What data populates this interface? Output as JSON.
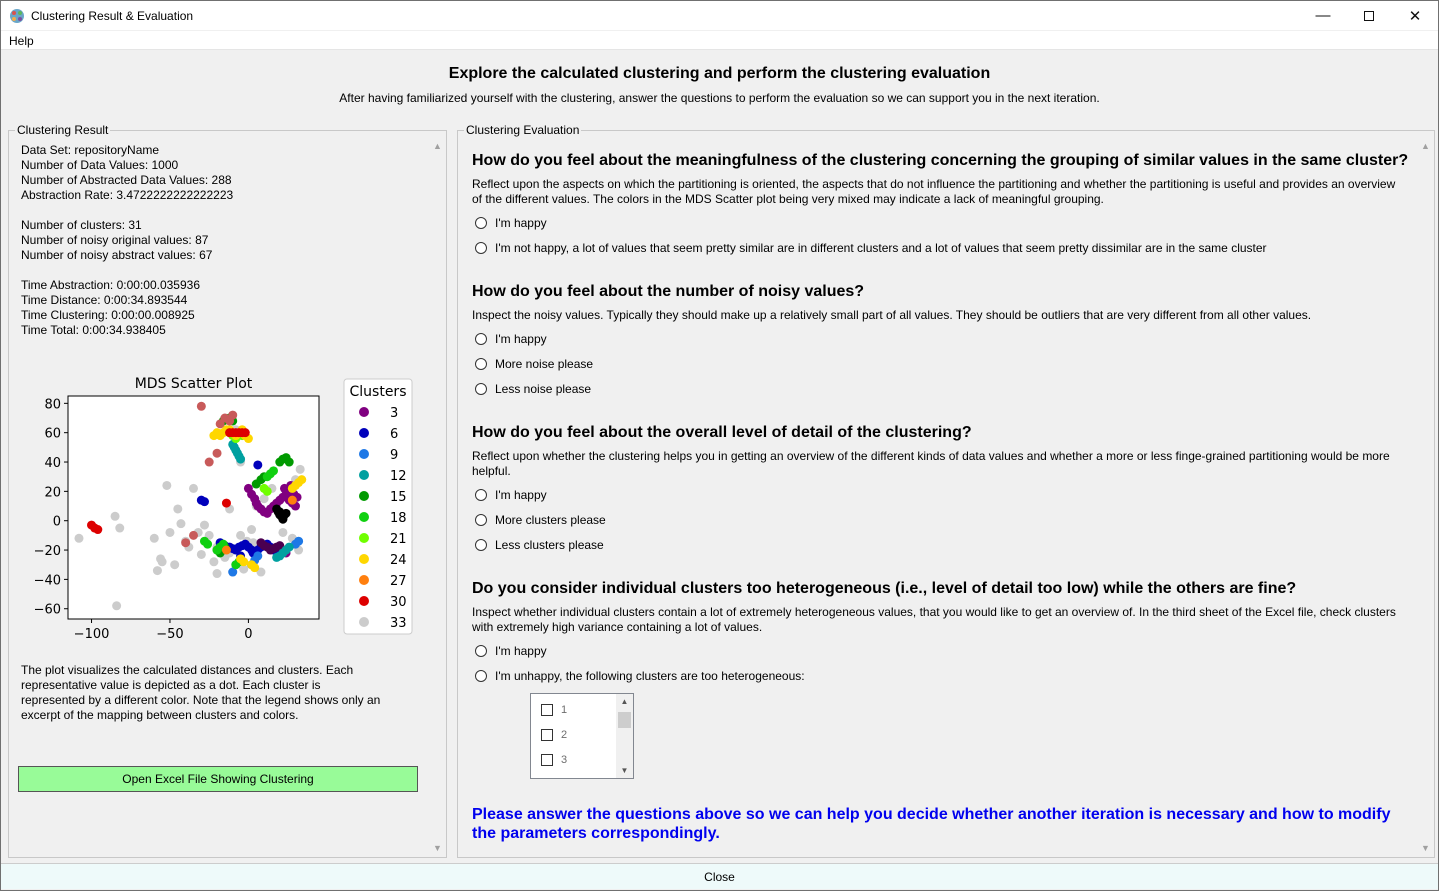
{
  "window": {
    "title": "Clustering Result & Evaluation",
    "minimize_icon": "minimize-icon",
    "maximize_icon": "maximize-icon",
    "close_icon": "close-icon"
  },
  "menu": {
    "help": "Help"
  },
  "header": {
    "title": "Explore the calculated clustering and perform the clustering evaluation",
    "subtitle": "After having familiarized yourself with the clustering, answer the questions to perform the evaluation so we can support you in the next iteration."
  },
  "left": {
    "group_title": "Clustering Result",
    "stats": [
      "Data Set: repositoryName",
      "Number of Data Values: 1000",
      "Number of Abstracted Data Values: 288",
      "Abstraction Rate: 3.4722222222222223",
      "",
      "Number of clusters: 31",
      "Number of noisy original values: 87",
      "Number of noisy abstract values: 67",
      "",
      "Time Abstraction: 0:00:00.035936",
      "Time Distance: 0:00:34.893544",
      "Time Clustering: 0:00:00.008925",
      "Time Total: 0:00:34.938405"
    ],
    "explanation": "The plot visualizes the calculated distances and clusters. Each representative value is depicted as a dot. Each cluster is represented by a different color. Note that the legend shows only an excerpt of the mapping between clusters and colors.",
    "excel_button": "Open Excel File Showing Clustering"
  },
  "chart_data": {
    "type": "scatter",
    "title": "MDS Scatter Plot",
    "xlabel": "",
    "ylabel": "",
    "xlim": [
      -115,
      45
    ],
    "ylim": [
      -67,
      85
    ],
    "x_ticks": [
      -100,
      -50,
      0
    ],
    "y_ticks": [
      80,
      60,
      40,
      20,
      0,
      -20,
      -40,
      -60
    ],
    "grid": false,
    "legend_title": "Clusters",
    "legend_placement": "right",
    "legend": [
      {
        "label": "3",
        "color": "#800080"
      },
      {
        "label": "6",
        "color": "#0000bb"
      },
      {
        "label": "9",
        "color": "#1e78e6"
      },
      {
        "label": "12",
        "color": "#00a0a0"
      },
      {
        "label": "15",
        "color": "#009a00"
      },
      {
        "label": "18",
        "color": "#10d010"
      },
      {
        "label": "21",
        "color": "#70ff00"
      },
      {
        "label": "24",
        "color": "#ffd700"
      },
      {
        "label": "27",
        "color": "#ff7f0e"
      },
      {
        "label": "30",
        "color": "#dd0000"
      },
      {
        "label": "33",
        "color": "#cccccc"
      }
    ],
    "series": [
      {
        "color": "#cccccc",
        "x": [
          -108,
          -85,
          -82,
          -60,
          -56,
          -52,
          -50,
          -47,
          -43,
          -40,
          -35,
          -30,
          -28,
          -25,
          -22,
          -20,
          -18,
          -12,
          -10,
          -8,
          -5,
          -3,
          -1,
          2,
          5,
          10,
          15,
          18,
          -55,
          -45,
          -38,
          -32,
          -15,
          -5,
          22,
          28,
          32,
          -84,
          -58,
          -20,
          -12,
          3,
          8,
          30,
          33
        ],
        "y": [
          -12,
          3,
          -5,
          -12,
          -26,
          24,
          -8,
          -30,
          -2,
          -14,
          22,
          -23,
          -3,
          -10,
          -28,
          -36,
          -15,
          -22,
          -35,
          62,
          40,
          -33,
          -14,
          -6,
          10,
          15,
          22,
          -18,
          -28,
          8,
          -18,
          -8,
          -25,
          -10,
          -8,
          -12,
          -20,
          -58,
          -34,
          -18,
          8,
          -15,
          -35,
          28,
          35
        ]
      },
      {
        "color": "#800080",
        "x": [
          0,
          2,
          4,
          5,
          6,
          8,
          10,
          12,
          14,
          16,
          18,
          20,
          22,
          24,
          26,
          28,
          30,
          25,
          23,
          27,
          29,
          31,
          20,
          22,
          24
        ],
        "y": [
          22,
          18,
          15,
          12,
          10,
          8,
          6,
          5,
          8,
          10,
          12,
          14,
          16,
          18,
          14,
          12,
          10,
          20,
          22,
          24,
          18,
          16,
          -18,
          -20,
          -22
        ]
      },
      {
        "color": "#0000bb",
        "x": [
          -18,
          -15,
          -12,
          -10,
          -8,
          -6,
          -4,
          -2,
          0,
          2,
          4,
          6,
          8,
          10,
          12,
          14,
          16,
          18,
          -30,
          -28,
          -5,
          3,
          6
        ],
        "y": [
          -15,
          -17,
          -18,
          -19,
          -20,
          -18,
          -17,
          -16,
          -18,
          -20,
          -22,
          -20,
          -18,
          -17,
          -16,
          -18,
          -20,
          -19,
          14,
          13,
          -24,
          -22,
          38
        ]
      },
      {
        "color": "#4b0050",
        "x": [
          8,
          10,
          12,
          14,
          16,
          18,
          20
        ],
        "y": [
          -15,
          -17,
          -18,
          -20,
          -19,
          -18,
          -17
        ]
      },
      {
        "color": "#000000",
        "x": [
          18,
          19,
          20,
          21,
          22,
          23,
          24,
          22,
          20
        ],
        "y": [
          8,
          6,
          4,
          3,
          2,
          4,
          5,
          1,
          6
        ]
      },
      {
        "color": "#1e78e6",
        "x": [
          -10,
          -8,
          2,
          4,
          6,
          30,
          32
        ],
        "y": [
          -35,
          -30,
          -30,
          -27,
          -24,
          -16,
          -14
        ]
      },
      {
        "color": "#00a0a0",
        "x": [
          -10,
          -9,
          -8,
          -7,
          -6,
          -5,
          18,
          20,
          22,
          24,
          26
        ],
        "y": [
          52,
          50,
          48,
          46,
          44,
          42,
          -25,
          -24,
          -22,
          -20,
          -18
        ]
      },
      {
        "color": "#009a00",
        "x": [
          -16,
          -14,
          -12,
          -10,
          5,
          8,
          10,
          20,
          22,
          24,
          26,
          -20,
          -18,
          -15
        ],
        "y": [
          68,
          69,
          70,
          68,
          25,
          28,
          30,
          40,
          42,
          43,
          40,
          -20,
          -22,
          -18
        ]
      },
      {
        "color": "#10d010",
        "x": [
          -28,
          -26,
          -20,
          -18,
          -16,
          -8,
          -6,
          12,
          14,
          16
        ],
        "y": [
          -14,
          -16,
          -20,
          -18,
          -16,
          -30,
          -28,
          30,
          32,
          34
        ]
      },
      {
        "color": "#70ff00",
        "x": [
          -12,
          -10,
          -8,
          -6,
          -4,
          10,
          12
        ],
        "y": [
          60,
          58,
          56,
          60,
          58,
          22,
          20
        ]
      },
      {
        "color": "#ffd700",
        "x": [
          -22,
          -20,
          -18,
          -16,
          -14,
          -12,
          -10,
          -8,
          -6,
          -4,
          -2,
          0,
          2,
          4,
          28,
          30,
          32,
          34,
          -5,
          -3
        ],
        "y": [
          58,
          60,
          58,
          60,
          62,
          62,
          60,
          58,
          60,
          62,
          58,
          56,
          -30,
          -32,
          22,
          24,
          26,
          28,
          -26,
          -28
        ]
      },
      {
        "color": "#ff7f0e",
        "x": [
          -14,
          28
        ],
        "y": [
          -20,
          14
        ]
      },
      {
        "color": "#dd0000",
        "x": [
          -100,
          -98,
          -96,
          -12,
          -10,
          -8,
          -6,
          -4,
          -2,
          -14
        ],
        "y": [
          -3,
          -5,
          -6,
          60,
          60,
          60,
          60,
          60,
          60,
          12
        ]
      },
      {
        "color": "#c85a5a",
        "x": [
          -30,
          -20,
          -25,
          -18,
          -15,
          -12,
          -10,
          -40,
          -35
        ],
        "y": [
          78,
          46,
          40,
          66,
          70,
          68,
          72,
          -15,
          -10
        ]
      }
    ]
  },
  "right": {
    "group_title": "Clustering Evaluation",
    "q1": {
      "title": "How do you feel about the meaningfulness of the clustering concerning the grouping of similar values in the same cluster?",
      "desc": "Reflect upon the aspects on which the partitioning is oriented, the aspects that do not influence the partitioning and whether the partitioning is useful and provides an overview of the different values. The colors in the MDS Scatter plot being very mixed may indicate a lack of meaningful grouping.",
      "options": [
        "I'm happy",
        "I'm not happy, a lot of values that seem pretty similar are in different clusters and a lot of values that seem pretty dissimilar are in the same cluster"
      ]
    },
    "q2": {
      "title": "How do you feel about the number of noisy values?",
      "desc": "Inspect the noisy values. Typically they should make up a relatively small part of all values. They should be outliers that are very different from all other values.",
      "options": [
        "I'm happy",
        "More noise please",
        "Less noise please"
      ]
    },
    "q3": {
      "title": "How do you feel about the overall level of detail of the clustering?",
      "desc": "Reflect upon whether the clustering helps you in getting an overview of the different kinds of data values and whether a more or less finge-grained partitioning would be more helpful.",
      "options": [
        "I'm happy",
        "More clusters please",
        "Less clusters please"
      ]
    },
    "q4": {
      "title": "Do you consider individual clusters too heterogeneous (i.e., level of detail too low) while the others are fine?",
      "desc": "Inspect whether individual clusters contain a lot of extremely heterogeneous values, that you would like to get an overview of. In the third sheet of the Excel file, check clusters with extremely high variance containing a lot of values.",
      "options": [
        "I'm happy",
        "I'm unhappy, the following clusters are too heterogeneous:"
      ],
      "clusters": [
        "1",
        "2",
        "3"
      ]
    },
    "final_note": "Please answer the questions above so we can help you decide whether another iteration is necessary and how to modify the parameters correspondingly."
  },
  "footer": {
    "close": "Close"
  }
}
